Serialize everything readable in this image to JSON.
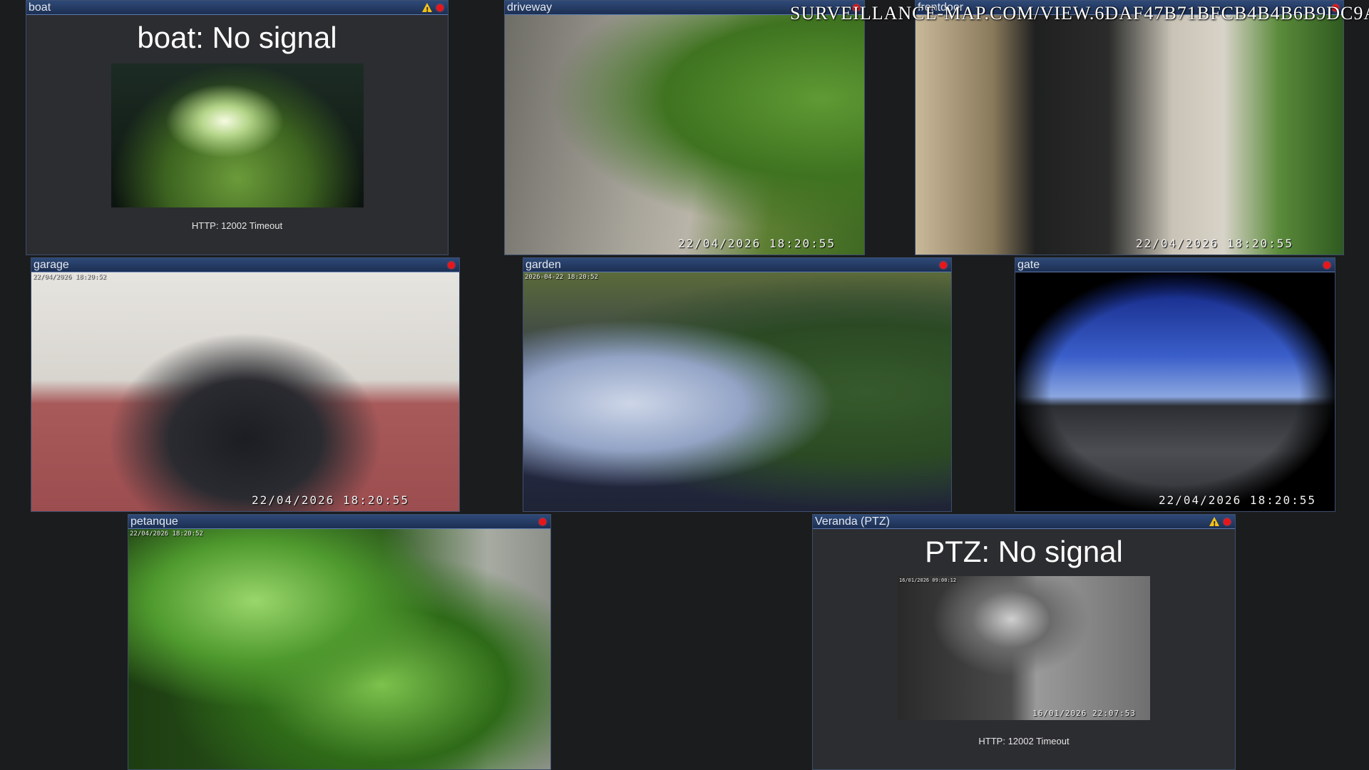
{
  "watermark": "SURVEILLANCE-MAP.COM/VIEW.6DAF47B71BFCB4B4B6B9DC9A",
  "cameras": [
    {
      "title": "boat",
      "no_signal_title": "boat: No signal",
      "error": "HTTP: 12002 Timeout",
      "warning": true,
      "recording": true
    },
    {
      "title": "driveway",
      "timestamp": "22/04/2026 18:20:55",
      "recording": true
    },
    {
      "title": "frontdoor",
      "timestamp": "22/04/2026 18:20:55",
      "recording": true
    },
    {
      "title": "garage",
      "timestamp": "22/04/2026 18:20:55",
      "small_stamp": "22/04/2026 18:20:52",
      "recording": true
    },
    {
      "title": "garden",
      "small_stamp": "2026-04-22 18:20:52",
      "recording": true
    },
    {
      "title": "gate",
      "timestamp": "22/04/2026 18:20:55",
      "recording": true
    },
    {
      "title": "petanque",
      "small_stamp": "22/04/2026 18:20:52",
      "recording": true
    },
    {
      "title": "Veranda (PTZ)",
      "no_signal_title": "PTZ: No signal",
      "error": "HTTP: 12002 Timeout",
      "warning": true,
      "recording": true,
      "thumb_stamp": "16/01/2026 22:07:53",
      "thumb_small_stamp": "16/01/2026 09:00:12"
    }
  ],
  "colors": {
    "background": "#1b1c1e",
    "panel": "#2c2d30",
    "header": "#2e4a78",
    "recording": "#e8161b",
    "warning": "#f3c218"
  }
}
